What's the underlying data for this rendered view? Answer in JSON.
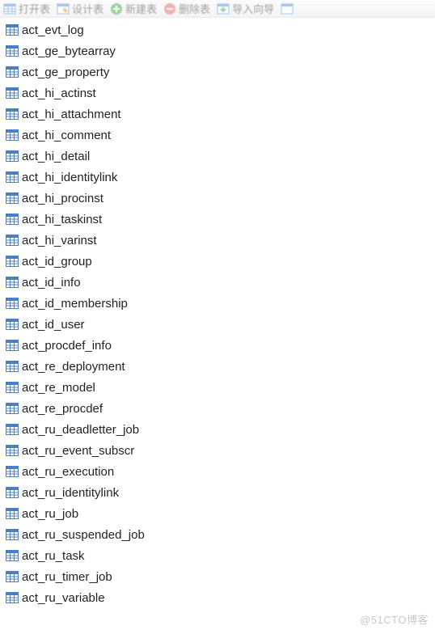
{
  "toolbar": {
    "open": "打开表",
    "design": "设计表",
    "new": "新建表",
    "delete": "删除表",
    "import": "导入向导"
  },
  "tables": [
    "act_evt_log",
    "act_ge_bytearray",
    "act_ge_property",
    "act_hi_actinst",
    "act_hi_attachment",
    "act_hi_comment",
    "act_hi_detail",
    "act_hi_identitylink",
    "act_hi_procinst",
    "act_hi_taskinst",
    "act_hi_varinst",
    "act_id_group",
    "act_id_info",
    "act_id_membership",
    "act_id_user",
    "act_procdef_info",
    "act_re_deployment",
    "act_re_model",
    "act_re_procdef",
    "act_ru_deadletter_job",
    "act_ru_event_subscr",
    "act_ru_execution",
    "act_ru_identitylink",
    "act_ru_job",
    "act_ru_suspended_job",
    "act_ru_task",
    "act_ru_timer_job",
    "act_ru_variable"
  ],
  "watermark": "@51CTO博客"
}
